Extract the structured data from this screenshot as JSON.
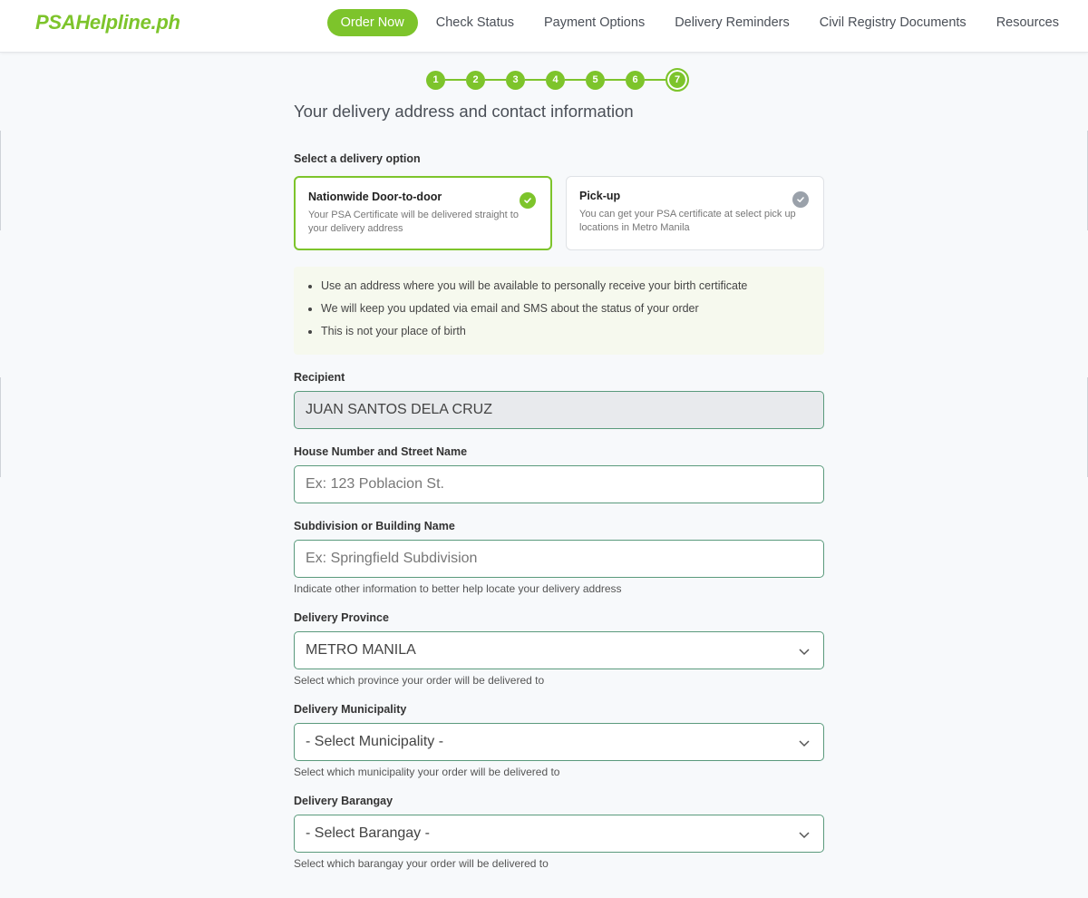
{
  "header": {
    "logo": "PSAHelpline.ph",
    "nav": [
      {
        "label": "Order Now",
        "active": true
      },
      {
        "label": "Check Status"
      },
      {
        "label": "Payment Options"
      },
      {
        "label": "Delivery Reminders"
      },
      {
        "label": "Civil Registry Documents"
      },
      {
        "label": "Resources"
      }
    ]
  },
  "stepper": {
    "steps": [
      "1",
      "2",
      "3",
      "4",
      "5",
      "6",
      "7"
    ],
    "current_step": 7
  },
  "page_title": "Your delivery address and contact information",
  "delivery": {
    "label": "Select a delivery option",
    "options": [
      {
        "title": "Nationwide Door-to-door",
        "description": "Your PSA Certificate will be delivered straight to your delivery address",
        "selected": true
      },
      {
        "title": "Pick-up",
        "description": "You can get your PSA certificate at select pick up locations in Metro Manila",
        "selected": false
      }
    ]
  },
  "tips": [
    "Use an address where you will be available to personally receive your birth certificate",
    "We will keep you updated via email and SMS about the status of your order",
    "This is not your place of birth"
  ],
  "fields": {
    "recipient": {
      "label": "Recipient",
      "value": "JUAN SANTOS DELA CRUZ"
    },
    "street": {
      "label": "House Number and Street Name",
      "placeholder": "Ex: 123 Poblacion St."
    },
    "subdivision": {
      "label": "Subdivision or Building Name",
      "placeholder": "Ex: Springfield Subdivision",
      "hint": "Indicate other information to better help locate your delivery address"
    },
    "province": {
      "label": "Delivery Province",
      "value": "METRO MANILA",
      "hint": "Select which province your order will be delivered to"
    },
    "municipality": {
      "label": "Delivery Municipality",
      "value": "- Select Municipality -",
      "hint": "Select which municipality your order will be delivered to"
    },
    "barangay": {
      "label": "Delivery Barangay",
      "value": "- Select Barangay -",
      "hint": "Select which barangay your order will be delivered to"
    }
  },
  "colors": {
    "brand": "#7dc42b",
    "input_border": "#5a9a7c",
    "inactive_check": "#9aa1aa"
  }
}
